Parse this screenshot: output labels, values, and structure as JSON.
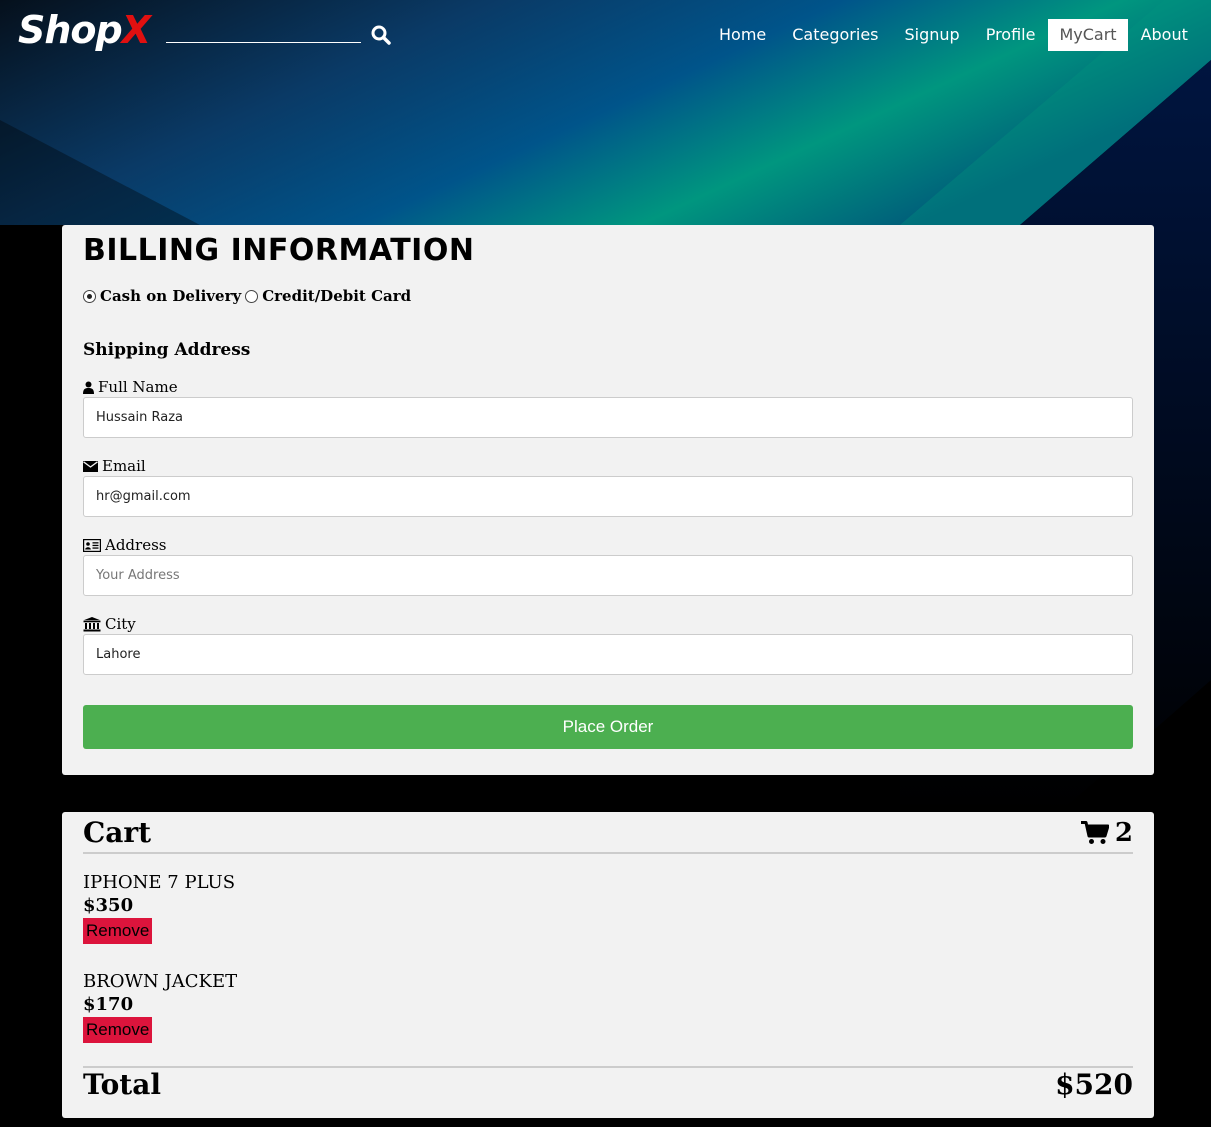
{
  "nav": {
    "logo_main": "Shop",
    "logo_accent": "X",
    "search_placeholder": "",
    "menu": [
      {
        "label": "Home",
        "active": false
      },
      {
        "label": "Categories",
        "active": false
      },
      {
        "label": "Signup",
        "active": false
      },
      {
        "label": "Profile",
        "active": false
      },
      {
        "label": "MyCart",
        "active": true
      },
      {
        "label": "About",
        "active": false
      }
    ]
  },
  "billing": {
    "title": "BILLING INFORMATION",
    "payment_options": [
      {
        "label": "Cash on Delivery",
        "selected": true
      },
      {
        "label": "Credit/Debit Card",
        "selected": false
      }
    ],
    "shipping_title": "Shipping Address",
    "fields": {
      "full_name": {
        "label": "Full Name",
        "value": "Hussain Raza",
        "placeholder": ""
      },
      "email": {
        "label": "Email",
        "value": "hr@gmail.com",
        "placeholder": ""
      },
      "address": {
        "label": "Address",
        "value": "",
        "placeholder": "Your Address"
      },
      "city": {
        "label": "City",
        "value": "Lahore",
        "placeholder": ""
      }
    },
    "place_order_label": "Place Order"
  },
  "cart": {
    "title": "Cart",
    "count": "2",
    "items": [
      {
        "name": "IPHONE 7 PLUS",
        "price": "$350",
        "remove_label": "Remove"
      },
      {
        "name": "BROWN JACKET",
        "price": "$170",
        "remove_label": "Remove"
      }
    ],
    "total_label": "Total",
    "total_value": "$520"
  },
  "colors": {
    "accent_green": "#4caf50",
    "remove_red": "#dc143c",
    "logo_red": "#e01010"
  }
}
